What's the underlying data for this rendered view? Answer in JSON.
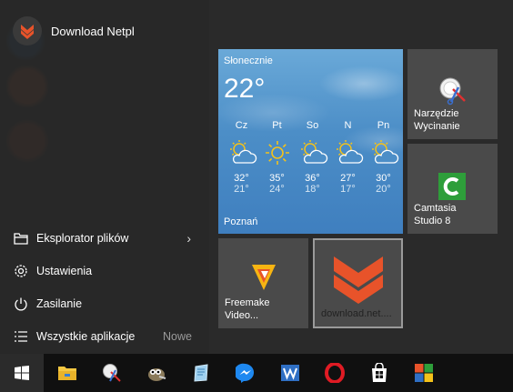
{
  "user": {
    "name": "Download Netpl",
    "avatar_icon": "downloadnet-chevrons-icon"
  },
  "menu": {
    "items": [
      {
        "label": "Eksplorator plików",
        "icon": "folder-icon"
      },
      {
        "label": "Ustawienia",
        "icon": "gear-icon"
      },
      {
        "label": "Zasilanie",
        "icon": "power-icon"
      },
      {
        "label": "Wszystkie aplikacje",
        "icon": "list-icon",
        "badge": "Nowe"
      }
    ]
  },
  "weather": {
    "condition": "Słonecznie",
    "temperature": "22°",
    "city": "Poznań",
    "days": [
      {
        "name": "Cz",
        "high": "32°",
        "low": "21°",
        "icon": "partly-cloudy-icon"
      },
      {
        "name": "Pt",
        "high": "35°",
        "low": "24°",
        "icon": "sun-icon"
      },
      {
        "name": "So",
        "high": "36°",
        "low": "18°",
        "icon": "partly-cloudy-icon"
      },
      {
        "name": "N",
        "high": "27°",
        "low": "17°",
        "icon": "partly-cloudy-icon"
      },
      {
        "name": "Pn",
        "high": "30°",
        "low": "20°",
        "icon": "partly-cloudy-icon"
      }
    ]
  },
  "tiles": {
    "snip": {
      "label": "Narzędzie Wycinanie",
      "icon": "scissors-icon"
    },
    "camtasia": {
      "label": "Camtasia Studio 8",
      "icon": "camtasia-icon"
    },
    "freemake": {
      "label": "Freemake Video...",
      "icon": "freemake-icon"
    },
    "download": {
      "label": "download.net....",
      "icon": "downloadnet-chevrons-icon"
    }
  },
  "taskbar": {
    "items": [
      "windows-start-icon",
      "file-explorer-icon",
      "snipping-tool-icon",
      "gimp-icon",
      "notepad-icon",
      "messenger-icon",
      "wps-writer-icon",
      "opera-icon",
      "store-icon",
      "office-icon"
    ]
  },
  "colors": {
    "accent_orange": "#e8532a",
    "weather_blue": "#4c8ec7",
    "sun_yellow": "#f4c21a"
  }
}
